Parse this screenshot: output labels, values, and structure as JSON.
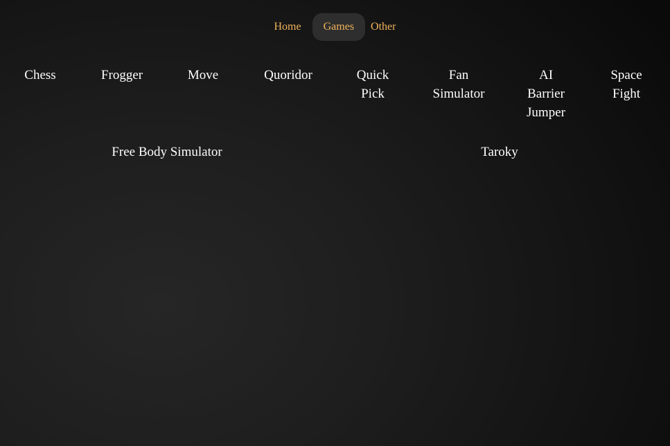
{
  "nav": {
    "items": [
      {
        "label": "Home",
        "active": false
      },
      {
        "label": "Games",
        "active": true
      },
      {
        "label": "Other",
        "active": false
      }
    ],
    "accent_color": "#f0b35a"
  },
  "games": [
    {
      "label": "Chess"
    },
    {
      "label": "Frogger"
    },
    {
      "label": "Move"
    },
    {
      "label": "Quoridor"
    },
    {
      "label": "Quick Pick"
    },
    {
      "label": "Fan Simulator"
    },
    {
      "label": "AI Barrier Jumper"
    },
    {
      "label": "Space Fight"
    },
    {
      "label": "Free Body Simulator"
    },
    {
      "label": "Taroky"
    }
  ]
}
